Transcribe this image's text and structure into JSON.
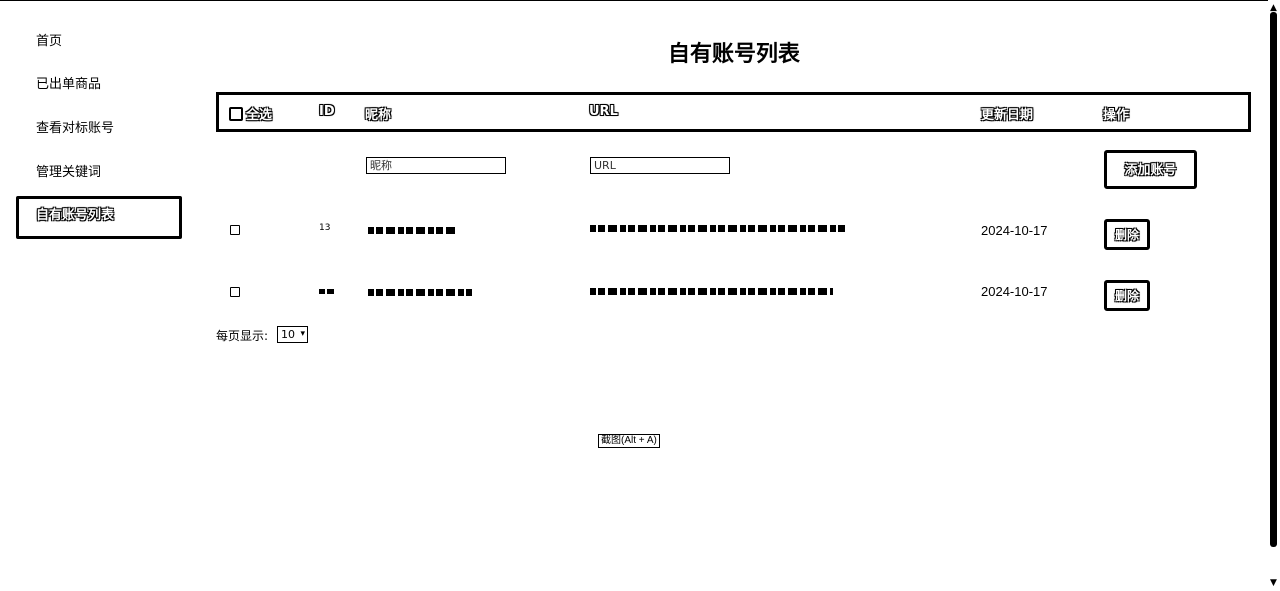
{
  "sidebar": {
    "items": [
      {
        "label": "首页"
      },
      {
        "label": "已出单商品"
      },
      {
        "label": "查看对标账号"
      },
      {
        "label": "管理关键词"
      },
      {
        "label": "自有账号列表"
      }
    ]
  },
  "page": {
    "title": "自有账号列表"
  },
  "table": {
    "headers": {
      "select_all": "全选",
      "id": "ID",
      "nickname": "昵称",
      "url": "URL",
      "update_date": "更新日期",
      "action": "操作"
    },
    "add_row": {
      "nickname_placeholder": "昵称",
      "url_placeholder": "URL",
      "add_button": "添加账号"
    },
    "rows": [
      {
        "id": "13",
        "date": "2024-10-17",
        "delete_label": "删除"
      },
      {
        "id": "",
        "date": "2024-10-17",
        "delete_label": "删除"
      }
    ]
  },
  "pagination": {
    "per_page_label": "每页显示:",
    "per_page_value": "10"
  },
  "screenshot_tip": "截图(Alt + A)",
  "icons": {
    "scroll_up": "triangle-up-icon",
    "scroll_down": "triangle-down-icon",
    "select_chevron": "chevron-down-icon"
  }
}
